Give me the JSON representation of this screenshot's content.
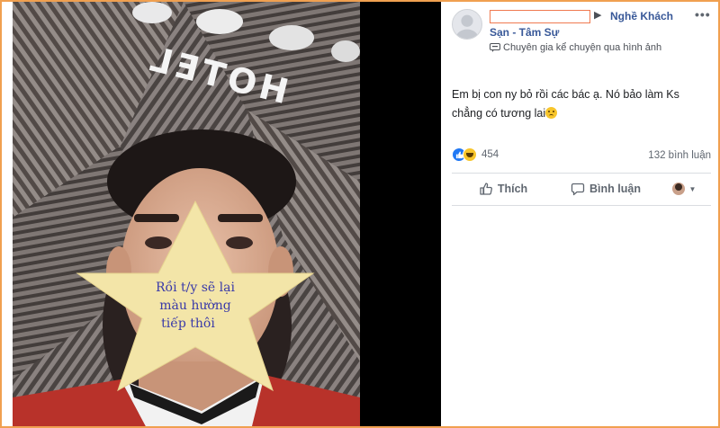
{
  "post": {
    "group_name": "Nghề Khách",
    "sub_name": "Sạn - Tâm Sự",
    "badge_text": "Chuyên gia kể chuyện qua hình ảnh",
    "arrow": "▶",
    "text": "Em bị con ny bỏ rồi các bác ạ. Nó bảo làm Ks chẳng có tương lai",
    "reaction_count": "454",
    "comment_count": "132 bình luận"
  },
  "actions": {
    "like_label": "Thích",
    "comment_label": "Bình luận"
  },
  "photo": {
    "star_text_line1": "Rồi t/y sẽ lại",
    "star_text_line2": "màu hường",
    "star_text_line3": "tiếp thôi",
    "wall_text": "HOTEL"
  },
  "colors": {
    "link": "#385898",
    "like_blue": "#2078f4",
    "star_fill": "#f3e5a8",
    "frame_border": "#f0a050"
  },
  "icons": [
    "avatar-placeholder-icon",
    "more-options-icon",
    "expert-badge-icon",
    "like-reaction-icon",
    "haha-reaction-icon",
    "thumbs-up-icon",
    "comment-bubble-icon",
    "sad-emoji-icon"
  ]
}
